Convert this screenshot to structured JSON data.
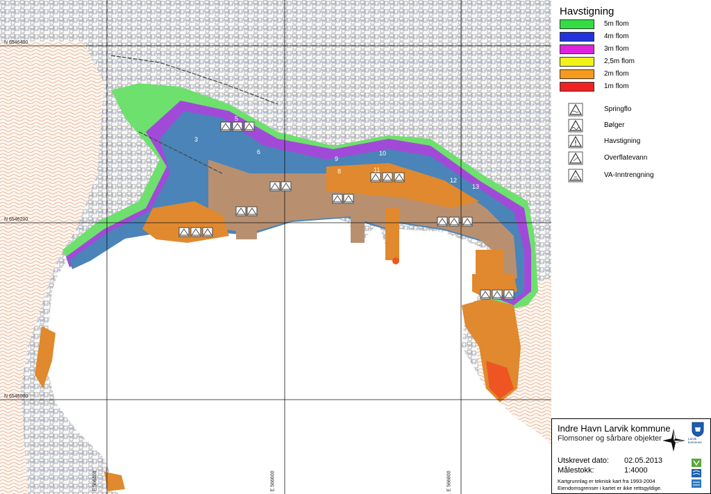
{
  "legend": {
    "title": "Havstigning",
    "flood_levels": [
      {
        "label": "5m flom",
        "color": "#33dd44"
      },
      {
        "label": "4m flom",
        "color": "#2233dd"
      },
      {
        "label": "3m flom",
        "color": "#dd22dd"
      },
      {
        "label": "2,5m flom",
        "color": "#f2f21a"
      },
      {
        "label": "2m flom",
        "color": "#f59a1f"
      },
      {
        "label": "1m flom",
        "color": "#ee2222"
      }
    ],
    "symbols": [
      {
        "label": "Springflo",
        "icon": "springflo-warning-icon"
      },
      {
        "label": "Bølger",
        "icon": "waves-warning-icon"
      },
      {
        "label": "Havstigning",
        "icon": "sea-rise-warning-icon"
      },
      {
        "label": "Overflatevann",
        "icon": "surface-water-warning-icon"
      },
      {
        "label": "VA-Inntrengning",
        "icon": "water-intrusion-warning-icon"
      }
    ]
  },
  "grid": {
    "north_labels": [
      "N 6546400",
      "N 6546200",
      "N 6546000"
    ],
    "east_labels": [
      "E 566400",
      "E 566600",
      "E 566800"
    ]
  },
  "zone_numbers": [
    "3",
    "5",
    "6",
    "9",
    "10",
    "11",
    "12",
    "13",
    "8"
  ],
  "titlebox": {
    "title": "Indre Havn Larvik kommune",
    "subtitle": "Flomsoner og sårbare objekter",
    "date_key": "Utskrevet dato:",
    "date_value": "02.05.2013",
    "scale_key": "Målestokk:",
    "scale_value": "1:4000",
    "note1": "Kartgrunnlag er teknisk kart fra 1993-2004",
    "note2": "Eiendomsgrenser i kartet er ikke rettsgyldige.",
    "logo_text": "Larvik kommune"
  },
  "colors": {
    "water": "#ffffff",
    "land": "#fbfbfb",
    "contour": "#d98a5a",
    "buildings": "#8a8a8a",
    "flood_blue": "#4a84b8",
    "flood_tan": "#b89070",
    "flood_orange": "#e0892e",
    "flood_green": "#6ee06e",
    "flood_purple": "#8844cc"
  }
}
